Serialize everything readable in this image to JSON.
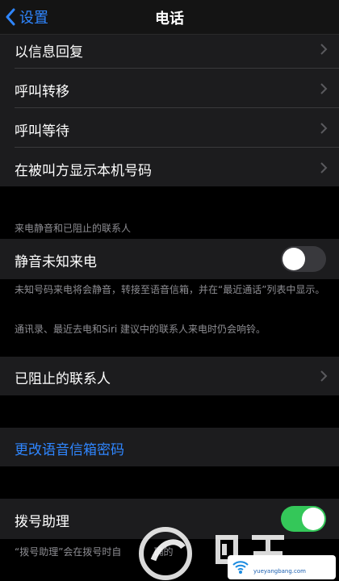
{
  "nav": {
    "back_label": "设置",
    "title": "电话"
  },
  "group1": [
    "以信息回复",
    "呼叫转移",
    "呼叫等待",
    "在被叫方显示本机号码"
  ],
  "silence": {
    "section_label": "来电静音和已阻止的联系人",
    "toggle_label": "静音未知来电",
    "toggle_on": false,
    "footer1": "未知号码来电将会静音，转接至语音信箱，并在“最近通话”列表中显示。",
    "footer2": "通讯录、最近去电和Siri 建议中的联系人来电时仍会响铃。"
  },
  "blocked": {
    "label": "已阻止的联系人"
  },
  "voicemail": {
    "label": "更改语音信箱密码"
  },
  "dial_assist": {
    "label": "拨号助理",
    "toggle_on": true,
    "footer_partial": "“拨号助理”会在拨号时自",
    "footer_partial2": "确的"
  },
  "watermark": {
    "site": "yueyangbang.com"
  },
  "colors": {
    "accent": "#2f86ff",
    "switch_on": "#34c759",
    "switch_off": "#39393d",
    "row_bg": "#1c1c1e"
  }
}
